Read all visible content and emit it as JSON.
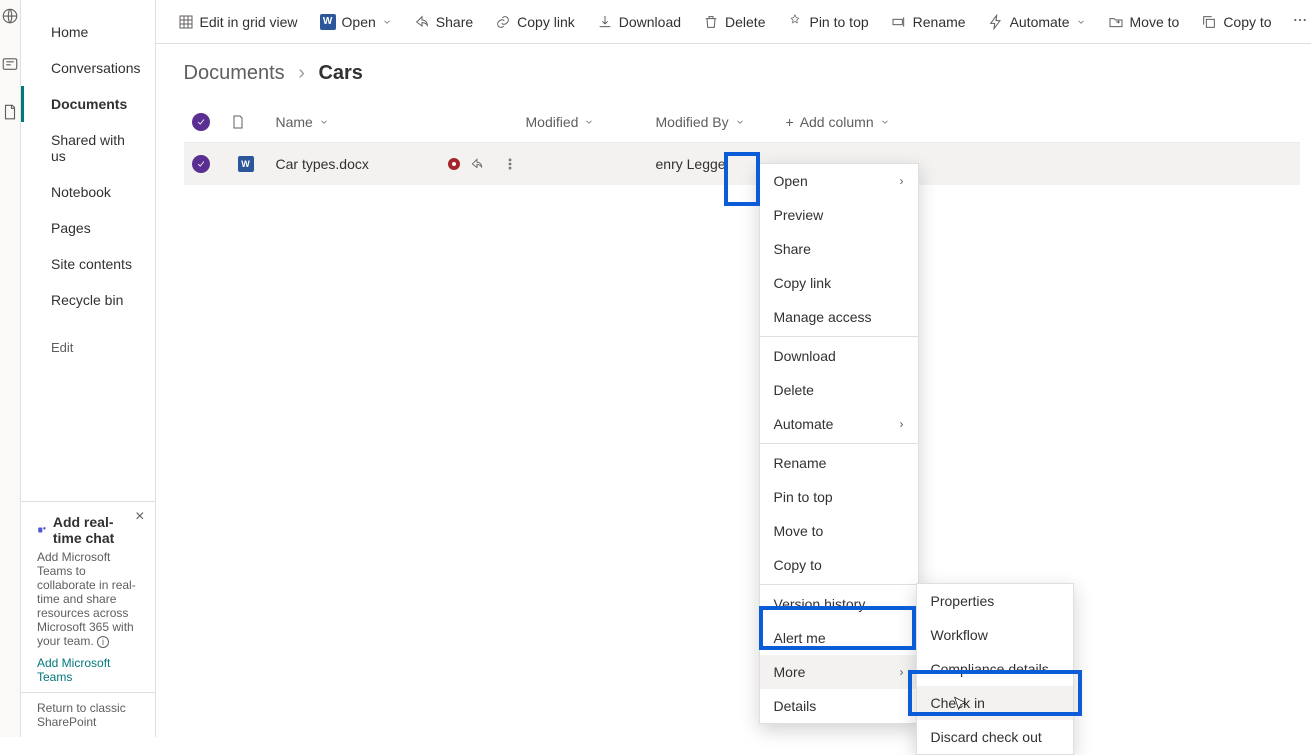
{
  "rail": {
    "icons": [
      "globe",
      "news",
      "page"
    ]
  },
  "sidebar": {
    "items": [
      {
        "label": "Home"
      },
      {
        "label": "Conversations"
      },
      {
        "label": "Documents",
        "active": true
      },
      {
        "label": "Shared with us"
      },
      {
        "label": "Notebook"
      },
      {
        "label": "Pages"
      },
      {
        "label": "Site contents"
      },
      {
        "label": "Recycle bin"
      }
    ],
    "edit_label": "Edit",
    "promo": {
      "title": "Add real-time chat",
      "body": "Add Microsoft Teams to collaborate in real-time and share resources across Microsoft 365 with your team.",
      "link": "Add Microsoft Teams"
    },
    "classic_link": "Return to classic SharePoint"
  },
  "toolbar": {
    "edit_grid": "Edit in grid view",
    "open": "Open",
    "share": "Share",
    "copy_link": "Copy link",
    "download": "Download",
    "delete": "Delete",
    "pin": "Pin to top",
    "rename": "Rename",
    "automate": "Automate",
    "move": "Move to",
    "copy": "Copy to"
  },
  "breadcrumb": {
    "parent": "Documents",
    "current": "Cars"
  },
  "columns": {
    "name": "Name",
    "modified": "Modified",
    "modified_by": "Modified By",
    "add": "Add column"
  },
  "row": {
    "filename": "Car types.docx",
    "modified": "",
    "modified_by": "enry Legge"
  },
  "context_menu": {
    "open": "Open",
    "preview": "Preview",
    "share": "Share",
    "copy_link": "Copy link",
    "manage_access": "Manage access",
    "download": "Download",
    "delete": "Delete",
    "automate": "Automate",
    "rename": "Rename",
    "pin": "Pin to top",
    "move": "Move to",
    "copy": "Copy to",
    "version_history": "Version history",
    "alert_me": "Alert me",
    "more": "More",
    "details": "Details"
  },
  "more_menu": {
    "properties": "Properties",
    "workflow": "Workflow",
    "compliance": "Compliance details",
    "check_in": "Check in",
    "discard": "Discard check out"
  }
}
